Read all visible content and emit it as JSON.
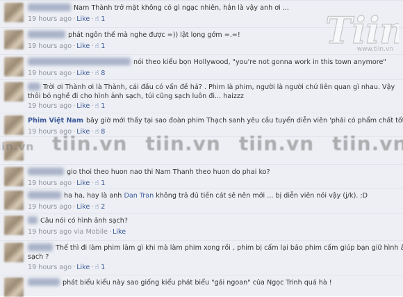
{
  "comments": [
    {
      "author": "",
      "text": "Nam Thành trở mặt không có gì ngạc nhiên, hắn là vậy anh ơi ...",
      "time": "19 hours ago",
      "like": "Like",
      "likes": "1",
      "via": ""
    },
    {
      "author": "",
      "text": "phát ngôn thế mà nghe được =)) lật lọng gớm =.=!",
      "time": "19 hours ago",
      "like": "Like",
      "likes": "1",
      "via": ""
    },
    {
      "author": "",
      "text": "nói theo kiểu bọn Hollywood, \"you're not gonna work in this town anymore\"",
      "time": "19 hours ago",
      "like": "Like",
      "likes": "8",
      "via": ""
    },
    {
      "author": "",
      "text": "Trời ơi Thành ơi là Thành, cái đầu có vấn đề hả? . Phim là phim, người là người chứ liên quan gì nhau. Vậy",
      "text2": "thôi bỏ nghề đi cho hình ảnh sạch, túi cũng sạch luôn đi... haizzz",
      "time": "19 hours ago",
      "like": "Like",
      "likes": "1",
      "via": ""
    },
    {
      "author": "Phim Việt Nam",
      "text": "bây giờ mới thấy tại sao đoàn phim Thạch sanh yêu cầu tuyển diễn viên 'phải có phẩm chất tốt' =))",
      "time": "19 hours ago",
      "like": "Like",
      "likes": "8",
      "via": ""
    },
    {
      "author": "",
      "text": "gio thoi theo huon nao thi Nam Thanh theo huon do phai ko?",
      "time": "19 hours ago",
      "like": "Like",
      "likes": "1",
      "via": ""
    },
    {
      "author": "",
      "text_before": "ha ha, hay là anh",
      "mention": "Dan Tran",
      "text": "không trả đủ tiền cát sê nên mới ... bị diễn viên nói vậy (j/k). :D",
      "time": "19 hours ago",
      "like": "Like",
      "likes": "2",
      "via": ""
    },
    {
      "author": "",
      "text": "Câu nói có hình ảnh sạch?",
      "time": "19 hours ago",
      "like": "Like",
      "likes": "",
      "via": "via Mobile"
    },
    {
      "author": "",
      "text": "Thế thì đi làm phim làm gì khi mà làm phim xong rồi , phim bị cấm lại bảo phim cấm giúp bạn giữ hình ảnh",
      "text2": "sạch ?",
      "time": "19 hours ago",
      "like": "Like",
      "likes": "1",
      "via": ""
    },
    {
      "author": "",
      "text": "phát biểu kiểu này sao giống kiểu phát biểu \"gái ngoan\" của Ngọc Trinh quá hà !",
      "time": "",
      "like": "",
      "likes": "",
      "via": ""
    }
  ],
  "watermark": {
    "small": "iin.vn",
    "big": "tiin.vn",
    "brand": "Tiin",
    "url": "www.tiin.vn"
  },
  "colors": {
    "background": "#edeff4",
    "link": "#3b5998",
    "meta": "#90949c"
  }
}
